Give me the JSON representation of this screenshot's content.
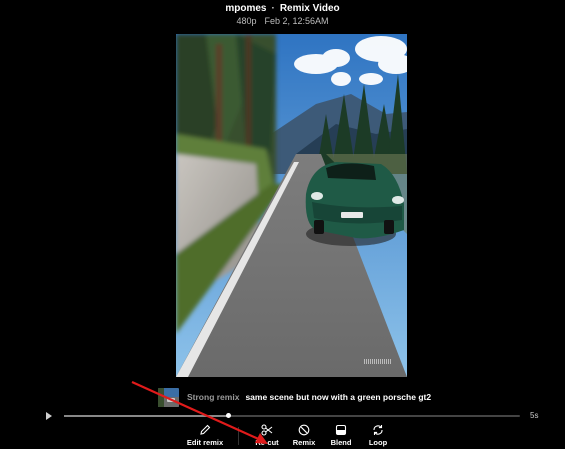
{
  "header": {
    "author": "mpomes",
    "separator": "·",
    "title": "Remix Video",
    "resolution": "480p",
    "date": "Feb 2, 12:56AM"
  },
  "caption": {
    "badge": "Strong remix",
    "prompt": "same scene but now with a green porsche gt2"
  },
  "player": {
    "progress": 0.36,
    "duration": "5s"
  },
  "toolbar": {
    "edit": "Edit remix",
    "recut": "Re-cut",
    "remix": "Remix",
    "blend": "Blend",
    "loop": "Loop"
  },
  "colors": {
    "annotation_arrow": "#e01b1b",
    "car": "#1f5a46",
    "sky": "#3a7fc8"
  }
}
